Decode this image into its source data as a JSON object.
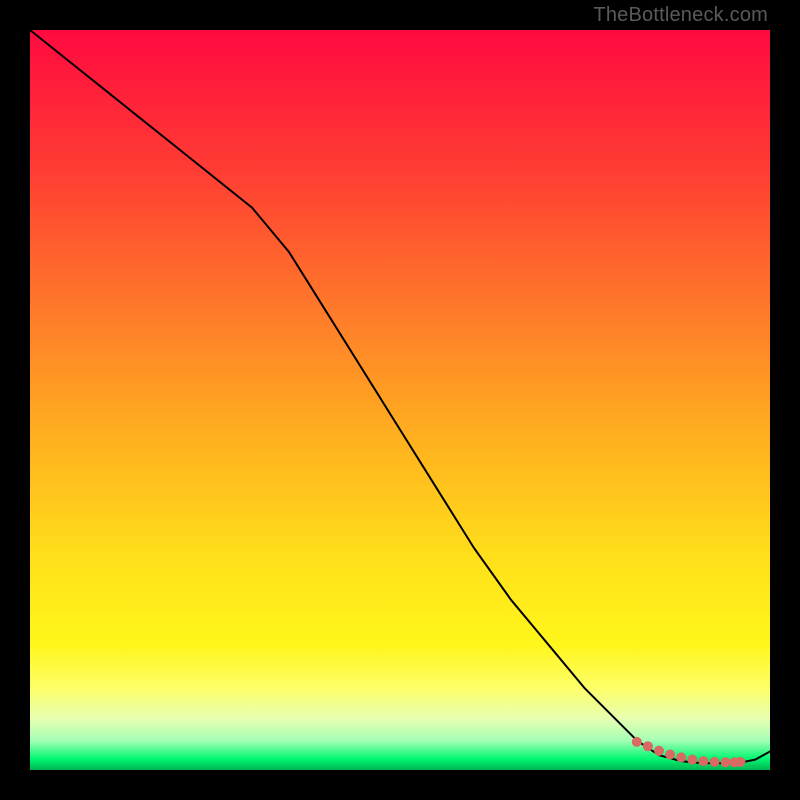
{
  "watermark": "TheBottleneck.com",
  "chart_data": {
    "type": "line",
    "title": "",
    "xlabel": "",
    "ylabel": "",
    "xlim": [
      0,
      100
    ],
    "ylim": [
      0,
      100
    ],
    "grid": false,
    "legend": false,
    "gradient_stops": [
      {
        "pos": 0.0,
        "color": "#ff0a3f"
      },
      {
        "pos": 0.18,
        "color": "#ff3a34"
      },
      {
        "pos": 0.38,
        "color": "#ff7a2a"
      },
      {
        "pos": 0.55,
        "color": "#ffb01f"
      },
      {
        "pos": 0.72,
        "color": "#ffe11a"
      },
      {
        "pos": 0.83,
        "color": "#fff61a"
      },
      {
        "pos": 0.89,
        "color": "#fdff6a"
      },
      {
        "pos": 0.93,
        "color": "#e8ffb0"
      },
      {
        "pos": 0.96,
        "color": "#a5ffb5"
      },
      {
        "pos": 0.985,
        "color": "#00f770"
      },
      {
        "pos": 1.0,
        "color": "#00b454"
      }
    ],
    "series": [
      {
        "name": "main-curve",
        "color": "#000000",
        "width": 2,
        "x": [
          0,
          5,
          10,
          15,
          20,
          25,
          30,
          35,
          40,
          45,
          50,
          55,
          60,
          65,
          70,
          75,
          80,
          82,
          85,
          88,
          90,
          92,
          94,
          96,
          98,
          100
        ],
        "y": [
          100,
          96,
          92,
          88,
          84,
          80,
          76,
          70,
          62,
          54,
          46,
          38,
          30,
          23,
          17,
          11,
          6,
          4,
          2,
          1.2,
          1.0,
          0.9,
          0.9,
          1.0,
          1.4,
          2.5
        ]
      },
      {
        "name": "highlight-band",
        "type": "scatter",
        "color": "#d96a63",
        "radius": 5,
        "x": [
          82,
          83.5,
          85,
          86.5,
          88,
          89.5,
          91,
          92.5,
          94,
          95.2,
          96
        ],
        "y": [
          3.8,
          3.2,
          2.6,
          2.1,
          1.7,
          1.4,
          1.2,
          1.1,
          1.05,
          1.05,
          1.1
        ]
      }
    ],
    "annotations": []
  }
}
